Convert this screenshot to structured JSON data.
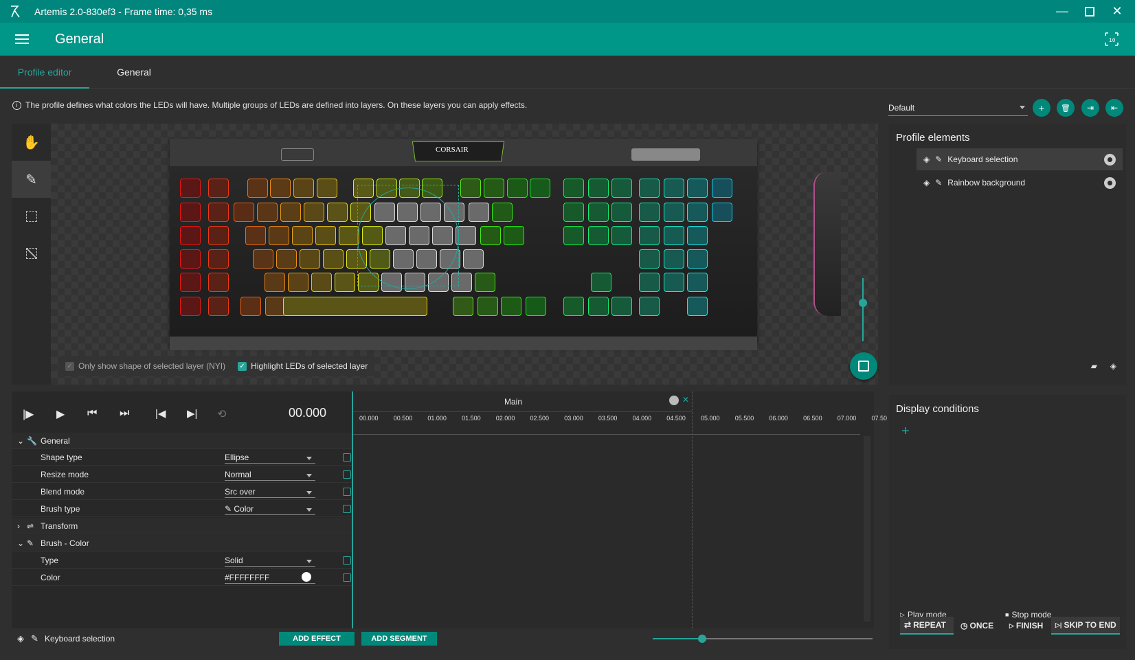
{
  "window": {
    "title": "Artemis 2.0-830ef3 - Frame time: 0,35 ms"
  },
  "appbar": {
    "title": "General"
  },
  "tabs": [
    {
      "label": "Profile editor"
    },
    {
      "label": "General"
    }
  ],
  "info": {
    "text": "The profile defines what colors the LEDs will have. Multiple groups of LEDs are defined into layers. On these layers you can apply effects."
  },
  "profile": {
    "selected": "Default"
  },
  "visualizer": {
    "brand": "CORSAIR",
    "only_show_shape_label": "Only show shape of selected layer (NYI)",
    "highlight_label": "Highlight LEDs of selected layer"
  },
  "profile_elements": {
    "title": "Profile elements",
    "items": [
      {
        "label": "Keyboard selection"
      },
      {
        "label": "Rainbow background"
      }
    ]
  },
  "display_conditions": {
    "title": "Display conditions"
  },
  "timeline": {
    "time": "00.000",
    "segment": "Main",
    "ruler": [
      "00.000",
      "00.500",
      "01.000",
      "01.500",
      "02.000",
      "02.500",
      "03.000",
      "03.500",
      "04.000",
      "04.500",
      "05.000",
      "05.500",
      "06.000",
      "06.500",
      "07.000",
      "07.50"
    ]
  },
  "properties": {
    "general": "General",
    "shape_type": {
      "label": "Shape type",
      "value": "Ellipse"
    },
    "resize_mode": {
      "label": "Resize mode",
      "value": "Normal"
    },
    "blend_mode": {
      "label": "Blend mode",
      "value": "Src over"
    },
    "brush_type": {
      "label": "Brush type",
      "value": "Color"
    },
    "transform": "Transform",
    "brush_color": "Brush - Color",
    "type": {
      "label": "Type",
      "value": "Solid"
    },
    "color": {
      "label": "Color",
      "value": "#FFFFFFFF"
    }
  },
  "footer": {
    "layer": "Keyboard selection",
    "add_effect": "ADD EFFECT",
    "add_segment": "ADD SEGMENT"
  },
  "modes": {
    "play_mode": "Play mode",
    "stop_mode": "Stop mode",
    "repeat": "REPEAT",
    "once": "ONCE",
    "finish": "FINISH",
    "skip_to_end": "SKIP TO END"
  },
  "colors": {
    "accent": "#009688",
    "titlebar": "#00867d",
    "background": "#2f2f2f"
  }
}
